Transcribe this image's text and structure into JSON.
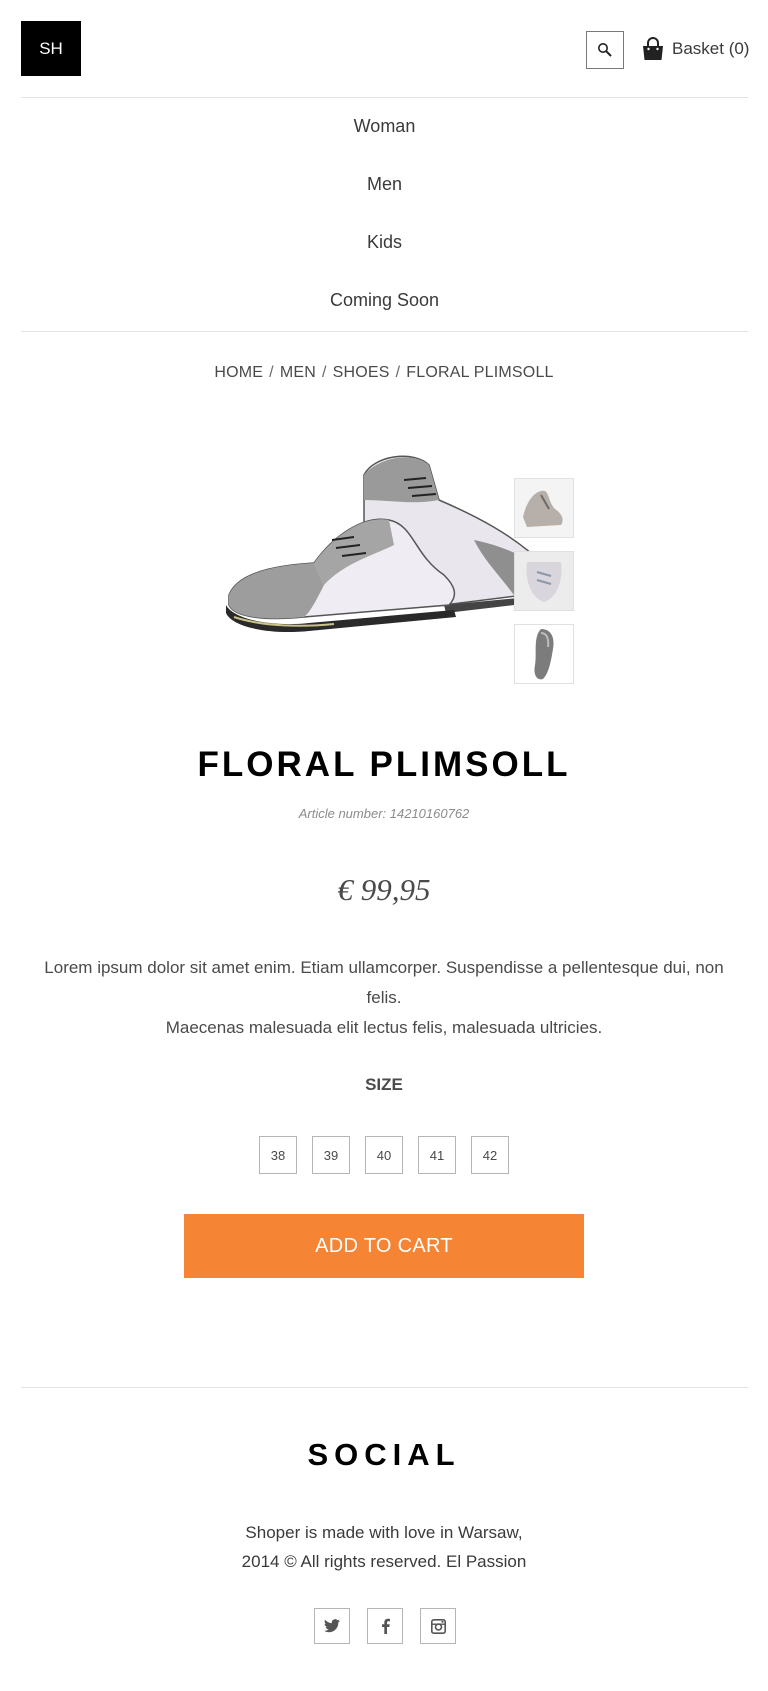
{
  "header": {
    "logo_text": "SH",
    "search_icon": "search-icon",
    "basket_icon": "shopping-bag-icon",
    "basket_label": "Basket (0)"
  },
  "nav": {
    "items": [
      "Woman",
      "Men",
      "Kids",
      "Coming Soon"
    ]
  },
  "breadcrumb": {
    "items": [
      "HOME",
      "MEN",
      "SHOES",
      "FLORAL PLIMSOLL"
    ],
    "separator": "/"
  },
  "product": {
    "title": "FLORAL PLIMSOLL",
    "article_number": "Article number: 14210160762",
    "price": "€ 99,95",
    "description_line1": "Lorem ipsum dolor sit amet enim. Etiam ullamcorper. Suspendisse a pellentesque dui, non felis.",
    "description_line2": "Maecenas malesuada elit lectus felis, malesuada ultricies.",
    "size_label": "SIZE",
    "sizes": [
      "38",
      "39",
      "40",
      "41",
      "42"
    ],
    "add_to_cart_label": "ADD TO CART"
  },
  "footer": {
    "social_title": "SOCIAL",
    "text_line1": "Shoper is made with love in Warsaw,",
    "text_line2": "2014 © All rights reserved. El Passion",
    "icons": [
      "twitter-icon",
      "facebook-icon",
      "instagram-icon"
    ]
  },
  "colors": {
    "accent": "#f58435",
    "logo_bg": "#000000",
    "text": "#3a3a3a",
    "muted": "#8c8c8c"
  }
}
